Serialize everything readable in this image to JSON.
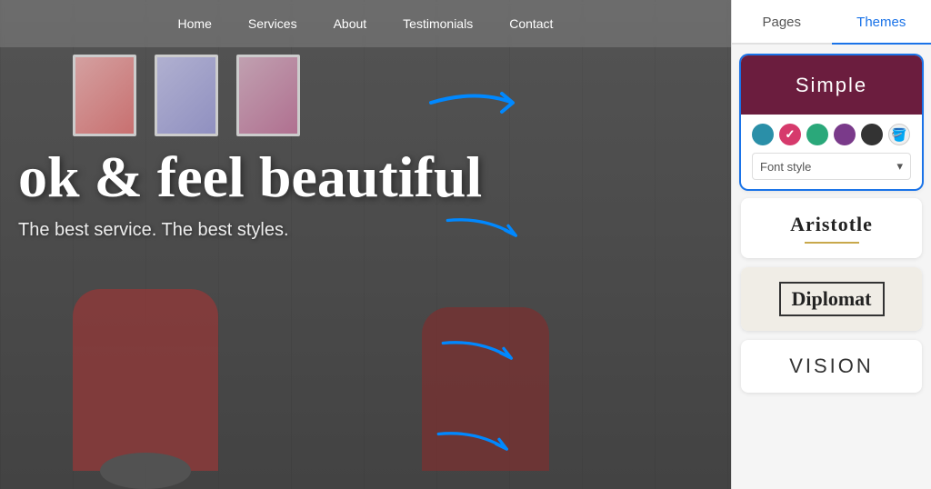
{
  "nav": {
    "links": [
      "Home",
      "Services",
      "About",
      "Testimonials",
      "Contact"
    ]
  },
  "hero": {
    "title": "ok & feel beautiful",
    "subtitle": "The best service. The best styles."
  },
  "sidebar": {
    "tabs": [
      {
        "label": "Pages",
        "active": false
      },
      {
        "label": "Themes",
        "active": true
      }
    ],
    "themes": [
      {
        "name": "simple",
        "label": "Simple",
        "active": true,
        "colors": [
          {
            "hex": "#2a8fa8",
            "selected": false
          },
          {
            "hex": "#d63a6c",
            "selected": true
          },
          {
            "hex": "#2aa87a",
            "selected": false
          },
          {
            "hex": "#7a3a8a",
            "selected": false
          },
          {
            "hex": "#333333",
            "selected": false
          }
        ],
        "font_style_label": "Font style",
        "dropdown_arrow": "▾"
      },
      {
        "name": "aristotle",
        "label": "Aristotle",
        "active": false,
        "line_color": "#c8a84b"
      },
      {
        "name": "diplomat",
        "label": "Diplomat",
        "active": false
      },
      {
        "name": "vision",
        "label": "Vision",
        "active": false
      }
    ]
  },
  "arrows": {
    "color": "#0080ff"
  }
}
